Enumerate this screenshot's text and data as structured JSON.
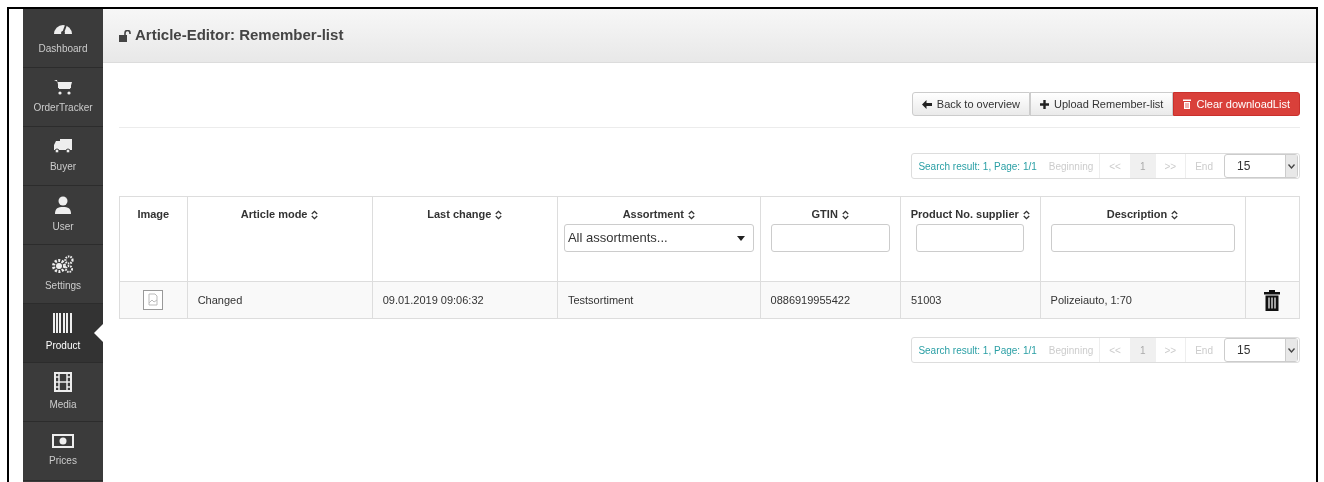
{
  "sidebar": {
    "items": [
      {
        "label": "Dashboard",
        "selected": false
      },
      {
        "label": "OrderTracker",
        "selected": false
      },
      {
        "label": "Buyer",
        "selected": false
      },
      {
        "label": "User",
        "selected": false
      },
      {
        "label": "Settings",
        "selected": false
      },
      {
        "label": "Product",
        "selected": true
      },
      {
        "label": "Media",
        "selected": false
      },
      {
        "label": "Prices",
        "selected": false
      }
    ]
  },
  "header": {
    "title": "Article-Editor: Remember-list"
  },
  "toolbar": {
    "buttons": [
      {
        "label": "Back to overview",
        "kind": "back"
      },
      {
        "label": "Upload Remember-list",
        "kind": "upload"
      },
      {
        "label": "Clear downloadList",
        "kind": "danger"
      }
    ]
  },
  "paginations": [
    {
      "summary": "Search result: 1, Page: 1/1",
      "first": "Beginning",
      "prev": "<<",
      "page": "1",
      "next": ">>",
      "last": "End",
      "page_size": "15"
    },
    {
      "summary": "Search result: 1, Page: 1/1",
      "first": "Beginning",
      "prev": "<<",
      "page": "1",
      "next": ">>",
      "last": "End",
      "page_size": "15"
    }
  ],
  "table": {
    "columns": [
      {
        "label": "Image",
        "kind": "plain"
      },
      {
        "label": "Article mode",
        "kind": "sortable"
      },
      {
        "label": "Last change",
        "kind": "sortable"
      },
      {
        "label": "Assortment",
        "kind": "dropdown",
        "filter_value": "All assortments..."
      },
      {
        "label": "GTIN",
        "kind": "search"
      },
      {
        "label": "Product No. supplier",
        "kind": "search"
      },
      {
        "label": "Description",
        "kind": "search"
      },
      {
        "kind": "action"
      }
    ],
    "rows": [
      {
        "cells": [
          {
            "kind": "image"
          },
          {
            "kind": "text",
            "text": "Changed"
          },
          {
            "kind": "text",
            "text": "09.01.2019 09:06:32"
          },
          {
            "kind": "text",
            "text": "Testsortiment"
          },
          {
            "kind": "text",
            "text": "0886919955422"
          },
          {
            "kind": "text",
            "text": "51003"
          },
          {
            "kind": "text",
            "text": "Polizeiauto, 1:70"
          },
          {
            "kind": "delete"
          }
        ]
      }
    ]
  }
}
